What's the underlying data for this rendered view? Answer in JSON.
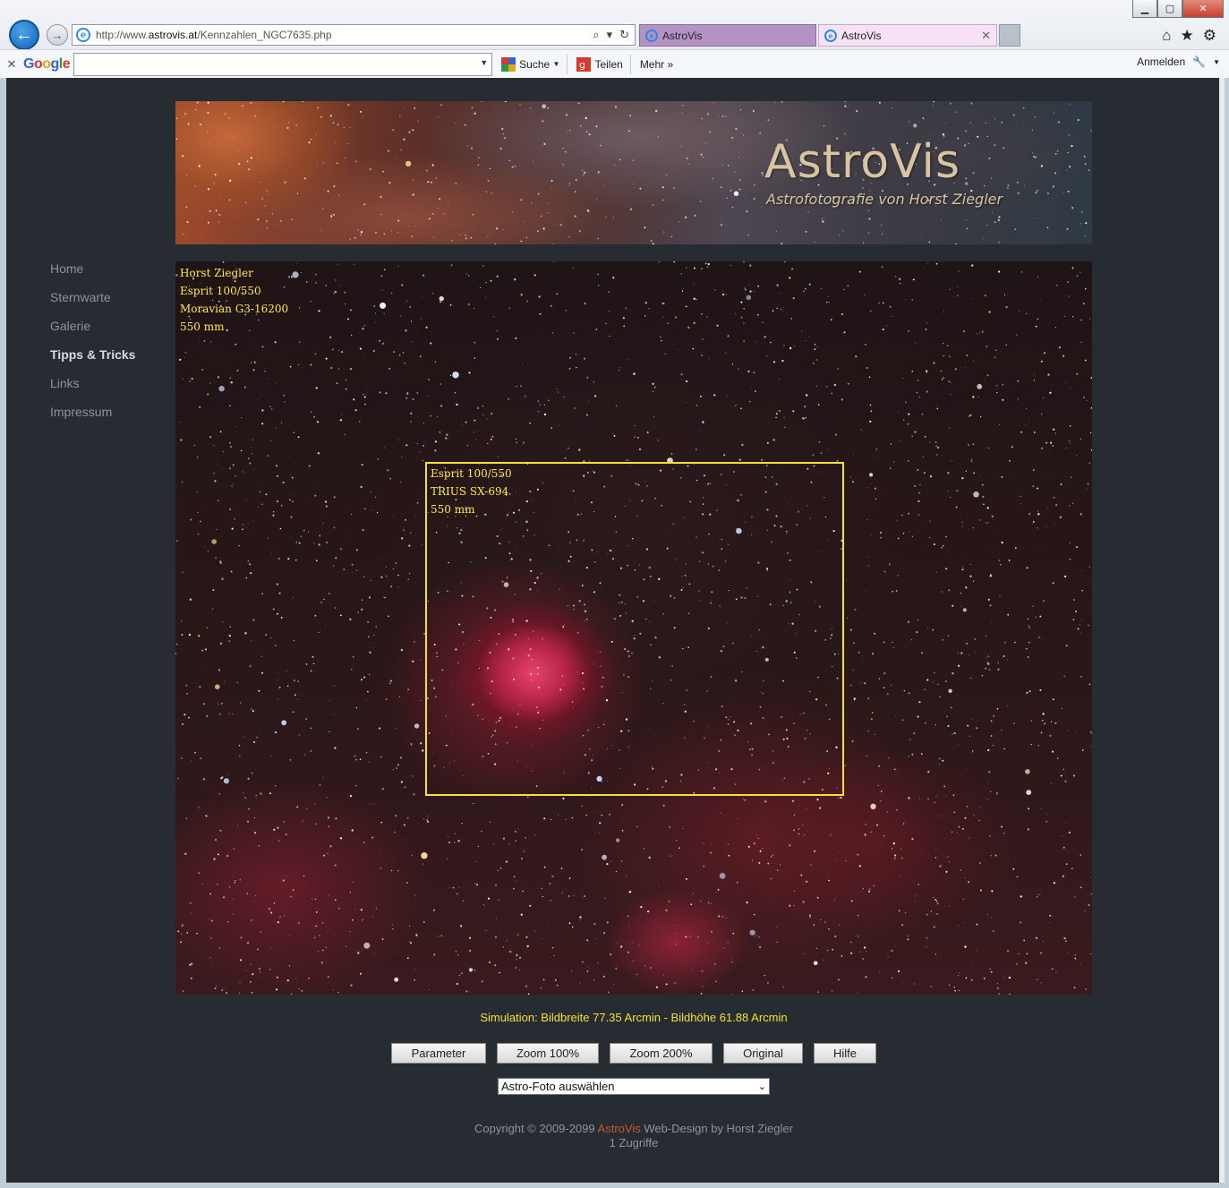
{
  "window": {
    "minimize_label": "▁",
    "maximize_label": "▢",
    "close_label": "✕"
  },
  "nav_buttons": {
    "back_label": "←",
    "forward_label": "→"
  },
  "address": {
    "prefix": "http://www.",
    "domain": "astrovis.at",
    "path": "/Kennzahlen_NGC7635.php",
    "tool_icons": [
      "⌕",
      "▾",
      "↻"
    ]
  },
  "tabs": [
    {
      "title": "AstroVis",
      "active": false,
      "color": "#b592c4"
    },
    {
      "title": "AstroVis",
      "active": true,
      "color": "#f7e1f5",
      "close_label": "✕"
    }
  ],
  "browser_icons": {
    "home": "⌂",
    "favorites": "★",
    "settings": "⚙"
  },
  "google_toolbar": {
    "close_label": "✕",
    "logo": [
      "G",
      "o",
      "o",
      "g",
      "l",
      "e"
    ],
    "search_value": "",
    "search_label": "Suche",
    "share_label": "Teilen",
    "more_label": "Mehr »",
    "signin_label": "Anmelden"
  },
  "site": {
    "banner": {
      "title": "AstroVis",
      "subtitle": "Astrofotografie von Horst Ziegler"
    },
    "nav": [
      {
        "label": "Home",
        "active": false
      },
      {
        "label": "Sternwarte",
        "active": false
      },
      {
        "label": "Galerie",
        "active": false
      },
      {
        "label": "Tipps & Tricks",
        "active": true
      },
      {
        "label": "Links",
        "active": false
      },
      {
        "label": "Impressum",
        "active": false
      }
    ],
    "photo_overlay": [
      "Horst Ziegler",
      "Esprit 100/550",
      "Moravian G3-16200",
      "550 mm"
    ],
    "sim_overlay": [
      "Esprit 100/550",
      "TRIUS SX-694",
      "550 mm"
    ],
    "sim_caption": "Simulation: Bildbreite 77.35 Arcmin - Bildhöhe 61.88 Arcmin",
    "buttons": [
      "Parameter",
      "Zoom 100%",
      "Zoom 200%",
      "Original",
      "Hilfe"
    ],
    "photo_select": {
      "selected": "Astro-Foto auswählen"
    },
    "footer": {
      "copyright_prefix": "Copyright © 2009-2099 ",
      "brand": "AstroVis",
      "copyright_suffix": " Web-Design by Horst Ziegler",
      "counter": "1 Zugriffe"
    }
  },
  "colors": {
    "overlay_text": "#ffe94a",
    "sim_frame": "#f2e233",
    "page_bg": "#262c31",
    "brand": "#c55a2d"
  }
}
